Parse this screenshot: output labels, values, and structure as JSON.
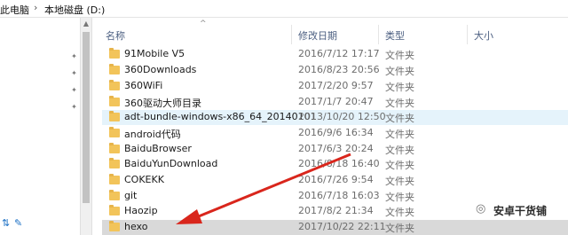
{
  "breadcrumb": {
    "items": [
      "此电脑",
      "本地磁盘 (D:)"
    ],
    "separator": "›"
  },
  "nav": {
    "pin_icon": "pin-icon",
    "bottom_icons": [
      "sync-icon",
      "wrench-icon"
    ]
  },
  "columns": {
    "name": "名称",
    "date": "修改日期",
    "type": "类型",
    "size": "大小"
  },
  "files": [
    {
      "name": "91Mobile V5",
      "date": "2016/7/12 17:17",
      "type": "文件夹"
    },
    {
      "name": "360Downloads",
      "date": "2016/8/23 20:56",
      "type": "文件夹"
    },
    {
      "name": "360WiFi",
      "date": "2017/2/20 9:57",
      "type": "文件夹"
    },
    {
      "name": "360驱动大师目录",
      "date": "2017/1/7 20:47",
      "type": "文件夹"
    },
    {
      "name": "adt-bundle-windows-x86_64_20140101",
      "date": "2013/10/20 12:50",
      "type": "文件夹"
    },
    {
      "name": "android代码",
      "date": "2016/9/6 16:34",
      "type": "文件夹"
    },
    {
      "name": "BaiduBrowser",
      "date": "2017/6/3 20:24",
      "type": "文件夹"
    },
    {
      "name": "BaiduYunDownload",
      "date": "2016/8/18 16:40",
      "type": "文件夹"
    },
    {
      "name": "COKEKK",
      "date": "2016/7/26 9:54",
      "type": "文件夹"
    },
    {
      "name": "git",
      "date": "2016/7/18 16:03",
      "type": "文件夹"
    },
    {
      "name": "Haozip",
      "date": "2017/8/2 21:34",
      "type": "文件夹"
    },
    {
      "name": "hexo",
      "date": "2017/10/22 22:11",
      "type": "文件夹"
    }
  ],
  "selected_index": 11,
  "hover_index": 4,
  "colors": {
    "annotation_arrow": "#d9261c",
    "folder": "#f2c45a",
    "selection": "#d9d9d9",
    "hover": "#e5f3fb"
  },
  "watermark": {
    "logo": "wechat-icon",
    "text": "安卓干货铺"
  }
}
